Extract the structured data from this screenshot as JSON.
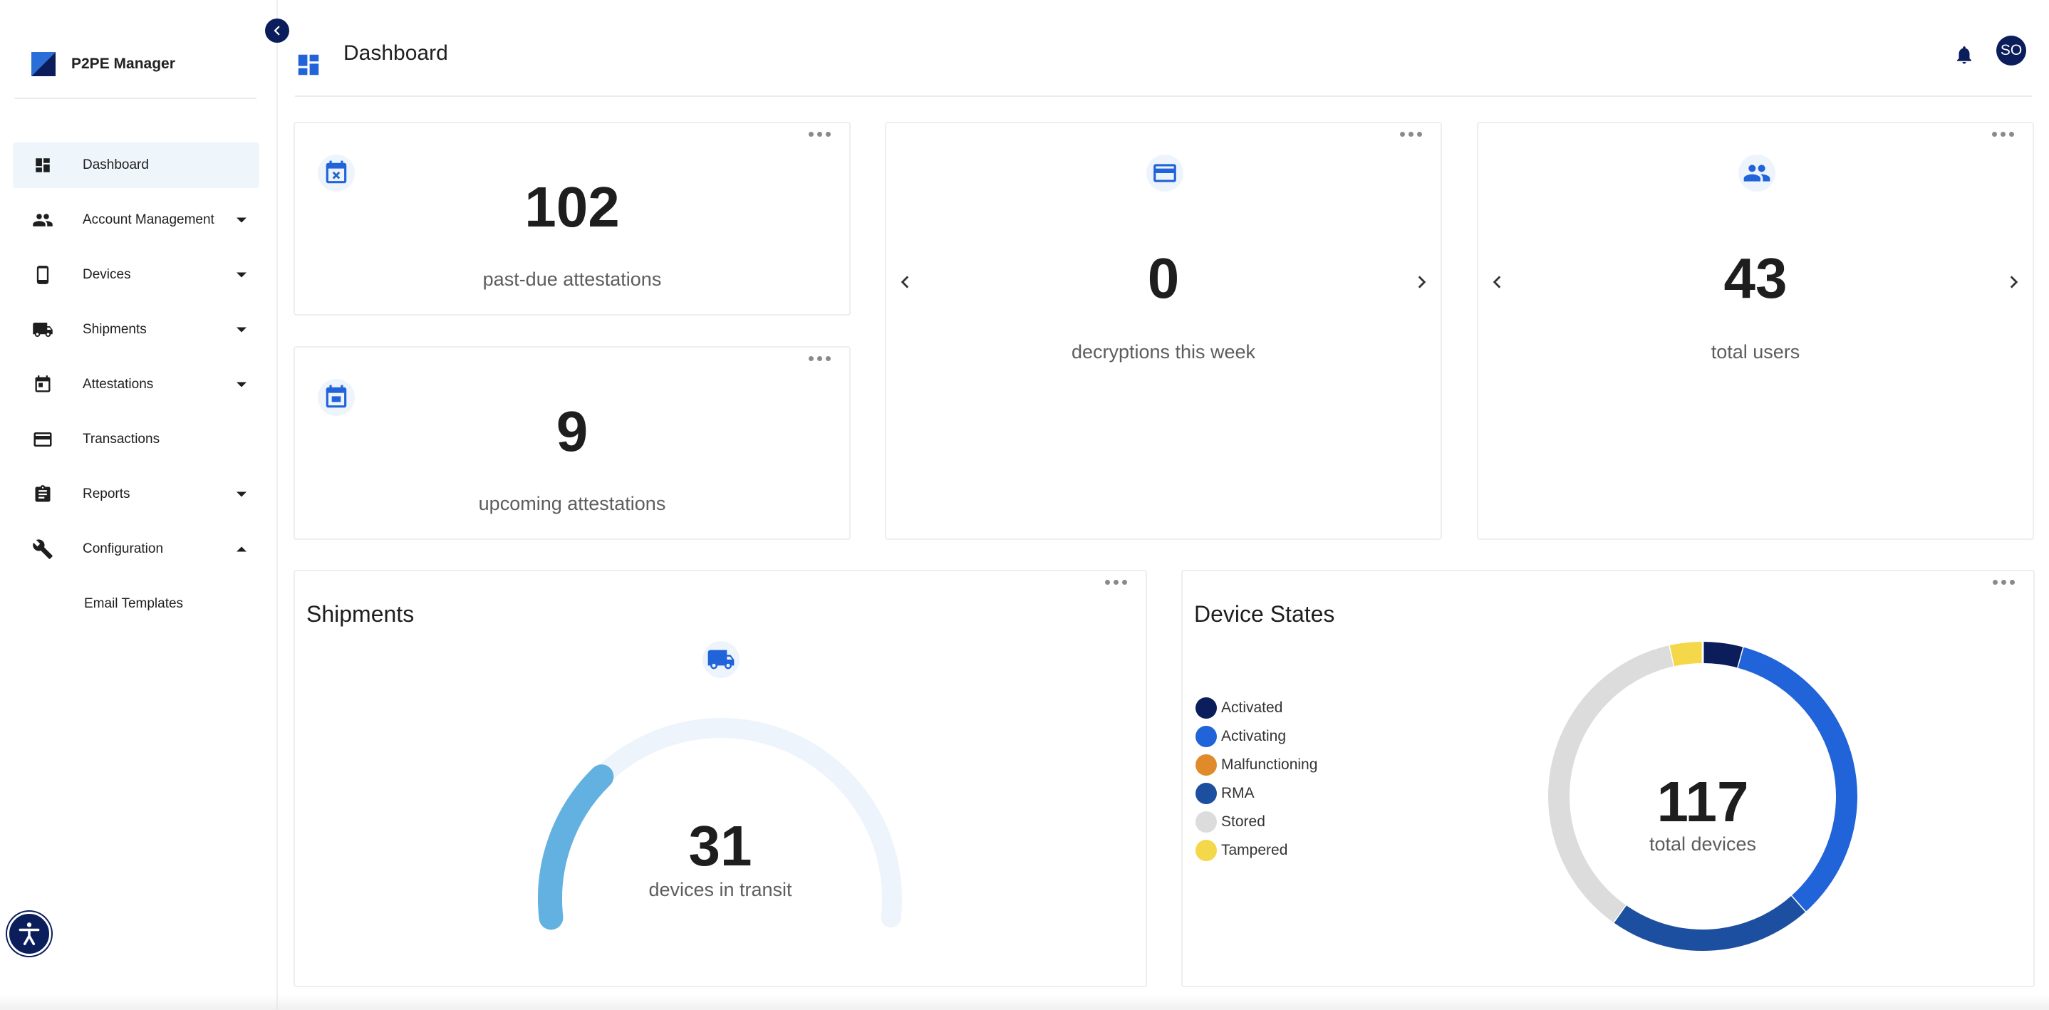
{
  "app": {
    "name": "P2PE Manager"
  },
  "header": {
    "title": "Dashboard",
    "avatar_initials": "SO"
  },
  "sidebar": {
    "items": [
      {
        "label": "Dashboard",
        "icon": "dashboard-icon",
        "active": true
      },
      {
        "label": "Account Management",
        "icon": "people-icon",
        "caret": "down"
      },
      {
        "label": "Devices",
        "icon": "phone-icon",
        "caret": "down"
      },
      {
        "label": "Shipments",
        "icon": "truck-icon",
        "caret": "down"
      },
      {
        "label": "Attestations",
        "icon": "calendar-icon",
        "caret": "down"
      },
      {
        "label": "Transactions",
        "icon": "credit-card-icon"
      },
      {
        "label": "Reports",
        "icon": "clipboard-icon",
        "caret": "down"
      },
      {
        "label": "Configuration",
        "icon": "wrench-icon",
        "caret": "up"
      }
    ],
    "subitems": [
      {
        "label": "Email Templates"
      }
    ]
  },
  "cards": {
    "past_due": {
      "value": "102",
      "label": "past-due attestations"
    },
    "upcoming": {
      "value": "9",
      "label": "upcoming attestations"
    },
    "decryptions": {
      "value": "0",
      "label": "decryptions this week"
    },
    "users": {
      "value": "43",
      "label": "total users"
    }
  },
  "shipments": {
    "title": "Shipments",
    "value": "31",
    "label": "devices in transit",
    "gauge_fraction": 0.27
  },
  "device_states": {
    "title": "Device States",
    "total": "117",
    "total_label": "total devices"
  },
  "chart_data": {
    "type": "pie",
    "title": "Device States",
    "legend_position": "left",
    "categories": [
      "Activated",
      "Activating",
      "Malfunctioning",
      "RMA",
      "Stored",
      "Tampered"
    ],
    "values": [
      5,
      40,
      0,
      25,
      43,
      4
    ],
    "colors": [
      "#0b1e5b",
      "#2163d8",
      "#e08a2c",
      "#1d4fa0",
      "#dcdcdc",
      "#f5d84a"
    ]
  },
  "colors": {
    "accent": "#2163d8",
    "navy": "#0b1e5b",
    "gauge_fill": "#62b1e0",
    "gauge_track": "#eef4fb"
  }
}
